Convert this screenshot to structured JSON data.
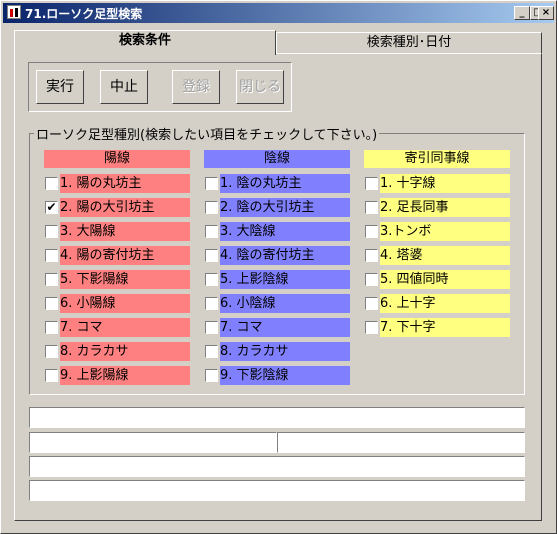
{
  "window": {
    "title": "71.ローソク足型検索",
    "controls": [
      {
        "icon": "minimize-icon",
        "glyph": "_"
      },
      {
        "icon": "maximize-icon",
        "glyph": "□"
      },
      {
        "icon": "close-icon",
        "glyph": "×"
      }
    ]
  },
  "tabs": [
    {
      "label": "検索条件",
      "active": true
    },
    {
      "label": "検索種別･日付",
      "active": false
    }
  ],
  "toolbar": {
    "run_label": "実行",
    "stop_label": "中止",
    "register_label": "登録",
    "close_label": "閉じる"
  },
  "group": {
    "label": "ローソク足型種別(検索したい項目をチェックして下さい。)"
  },
  "colors": {
    "yosen": "#ff8080",
    "insen": "#8080ff",
    "doji": "#ffff80"
  },
  "columns": {
    "yosen": {
      "header": "陽線",
      "items": [
        {
          "label": "1. 陽の丸坊主",
          "checked": false
        },
        {
          "label": "2. 陽の大引坊主",
          "checked": true
        },
        {
          "label": "3. 大陽線",
          "checked": false
        },
        {
          "label": "4. 陽の寄付坊主",
          "checked": false
        },
        {
          "label": "5. 下影陽線",
          "checked": false
        },
        {
          "label": "6. 小陽線",
          "checked": false
        },
        {
          "label": "7. コマ",
          "checked": false
        },
        {
          "label": "8. カラカサ",
          "checked": false
        },
        {
          "label": "9. 上影陽線",
          "checked": false
        }
      ]
    },
    "insen": {
      "header": "陰線",
      "items": [
        {
          "label": "1. 陰の丸坊主",
          "checked": false
        },
        {
          "label": "2. 陰の大引坊主",
          "checked": false
        },
        {
          "label": "3. 大陰線",
          "checked": false
        },
        {
          "label": "4. 陰の寄付坊主",
          "checked": false
        },
        {
          "label": "5. 上影陰線",
          "checked": false
        },
        {
          "label": "6. 小陰線",
          "checked": false
        },
        {
          "label": "7. コマ",
          "checked": false
        },
        {
          "label": "8. カラカサ",
          "checked": false
        },
        {
          "label": "9. 下影陰線",
          "checked": false
        }
      ]
    },
    "doji": {
      "header": "寄引同事線",
      "items": [
        {
          "label": "1. 十字線",
          "checked": false
        },
        {
          "label": "2. 足長同事",
          "checked": false
        },
        {
          "label": "3.トンボ",
          "checked": false
        },
        {
          "label": "4. 塔婆",
          "checked": false
        },
        {
          "label": "5. 四値同時",
          "checked": false
        },
        {
          "label": "6. 上十字",
          "checked": false
        },
        {
          "label": "7. 下十字",
          "checked": false
        }
      ]
    }
  },
  "status": {
    "line1": "",
    "line2_left": "",
    "line2_right": "",
    "line3": "",
    "line4": ""
  }
}
